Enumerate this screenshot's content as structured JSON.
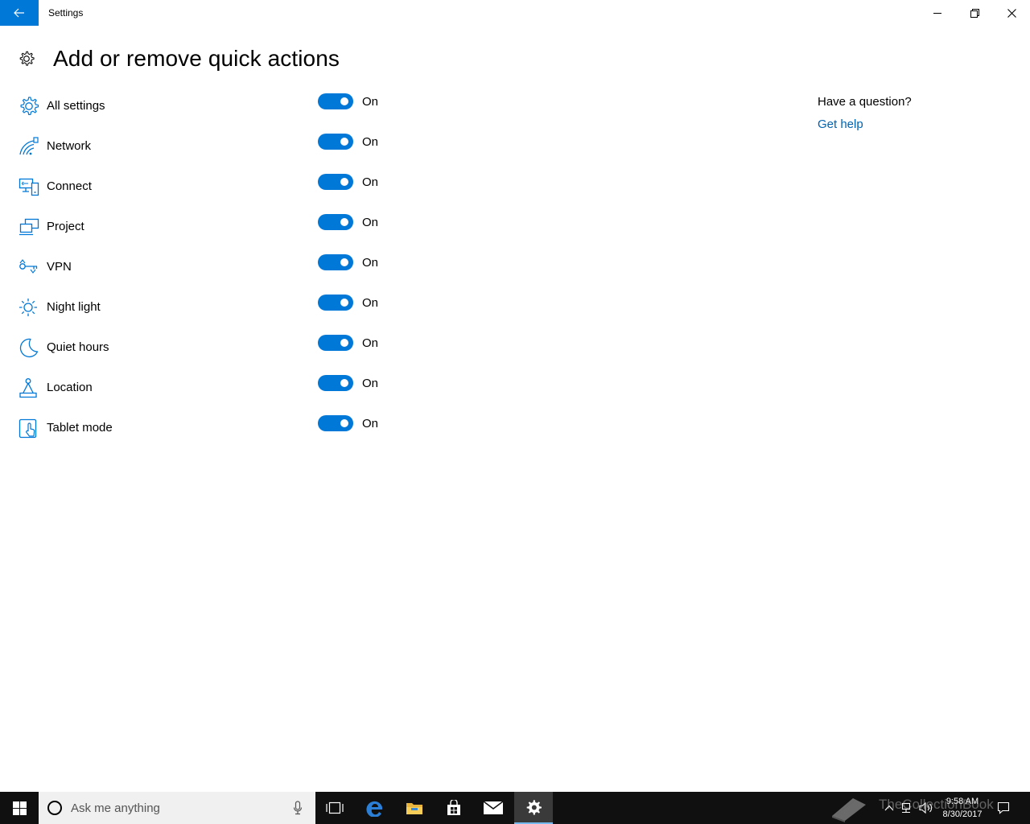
{
  "window": {
    "title": "Settings"
  },
  "page": {
    "title": "Add or remove quick actions"
  },
  "actions": [
    {
      "label": "All settings",
      "icon": "gear-icon",
      "state": "On"
    },
    {
      "label": "Network",
      "icon": "network-icon",
      "state": "On"
    },
    {
      "label": "Connect",
      "icon": "connect-icon",
      "state": "On"
    },
    {
      "label": "Project",
      "icon": "project-icon",
      "state": "On"
    },
    {
      "label": "VPN",
      "icon": "vpn-icon",
      "state": "On"
    },
    {
      "label": "Night light",
      "icon": "night-light-icon",
      "state": "On"
    },
    {
      "label": "Quiet hours",
      "icon": "moon-icon",
      "state": "On"
    },
    {
      "label": "Location",
      "icon": "location-icon",
      "state": "On"
    },
    {
      "label": "Tablet mode",
      "icon": "tablet-mode-icon",
      "state": "On"
    }
  ],
  "help": {
    "question": "Have a question?",
    "link": "Get help"
  },
  "taskbar": {
    "search_placeholder": "Ask me anything",
    "time": "9:58 AM",
    "date": "8/30/2017",
    "watermark": "TheCollectionBook"
  },
  "colors": {
    "accent": "#0078d7",
    "link": "#0063b1",
    "taskbar": "#101010"
  }
}
